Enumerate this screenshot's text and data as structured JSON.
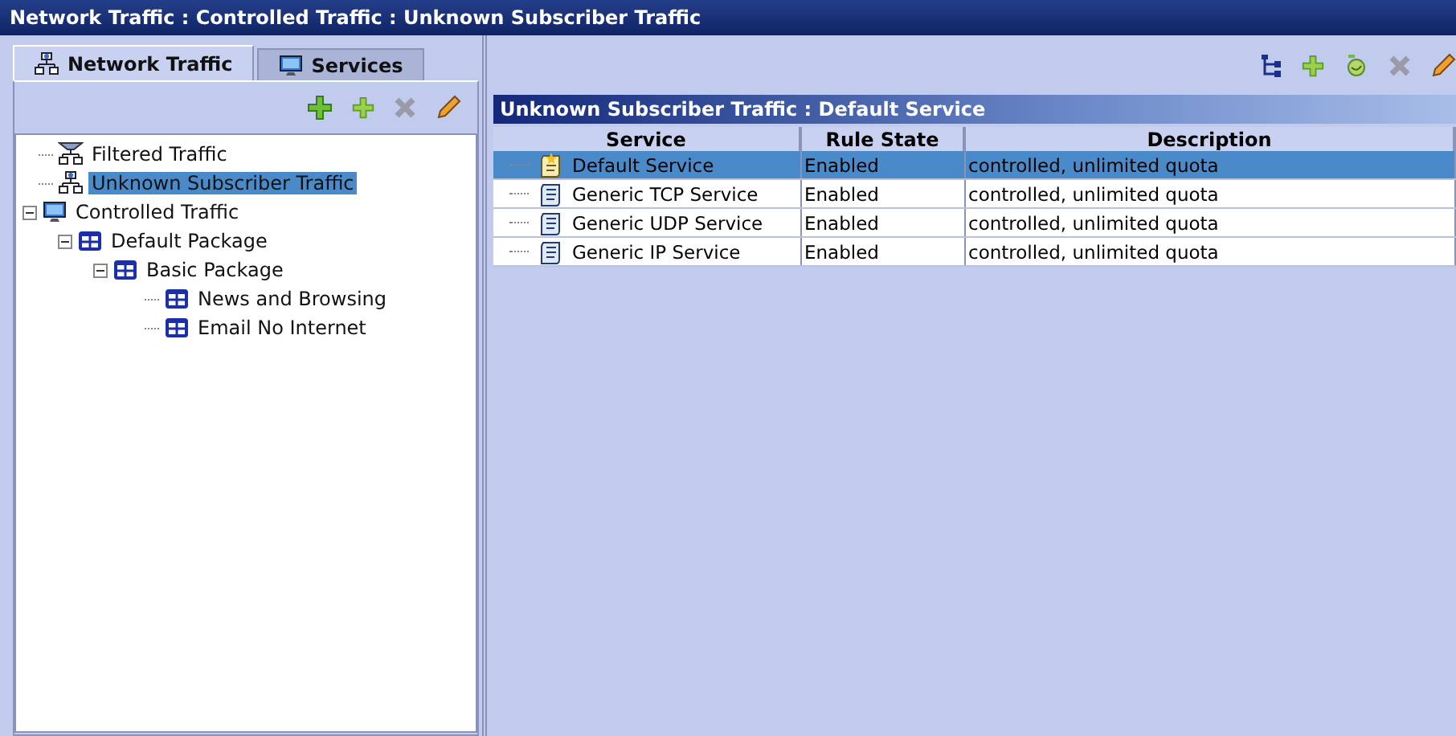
{
  "window": {
    "title": "Network Traffic : Controlled Traffic : Unknown Subscriber Traffic"
  },
  "tabs": [
    {
      "label": "Network Traffic",
      "selected": true,
      "kind": "network"
    },
    {
      "label": "Services",
      "selected": false,
      "kind": "monitor"
    }
  ],
  "tree": [
    {
      "label": "Filtered Traffic",
      "kind": "filter",
      "selected": false
    },
    {
      "label": "Unknown Subscriber Traffic",
      "kind": "network",
      "selected": true
    },
    {
      "label": "Controlled Traffic",
      "kind": "monitor",
      "selected": false,
      "expanded": true,
      "children": [
        {
          "label": "Default Package",
          "kind": "package",
          "selected": false,
          "expanded": true,
          "children": [
            {
              "label": "Basic Package",
              "kind": "package",
              "selected": false,
              "expanded": true,
              "children": [
                {
                  "label": "News and Browsing",
                  "kind": "package",
                  "selected": false
                },
                {
                  "label": "Email No Internet",
                  "kind": "package",
                  "selected": false
                }
              ]
            }
          ]
        }
      ]
    }
  ],
  "detail": {
    "title": "Unknown Subscriber Traffic : Default Service",
    "columns": [
      "Service",
      "Rule State",
      "Description"
    ],
    "rows": [
      {
        "kind": "default",
        "service": "Default Service",
        "rule_state": "Enabled",
        "description": "controlled, unlimited quota",
        "selected": true
      },
      {
        "kind": "service",
        "service": "Generic TCP Service",
        "rule_state": "Enabled",
        "description": "controlled, unlimited quota",
        "selected": false
      },
      {
        "kind": "service",
        "service": "Generic UDP Service",
        "rule_state": "Enabled",
        "description": "controlled, unlimited quota",
        "selected": false
      },
      {
        "kind": "service",
        "service": "Generic IP Service",
        "rule_state": "Enabled",
        "description": "controlled, unlimited quota",
        "selected": false
      }
    ]
  }
}
